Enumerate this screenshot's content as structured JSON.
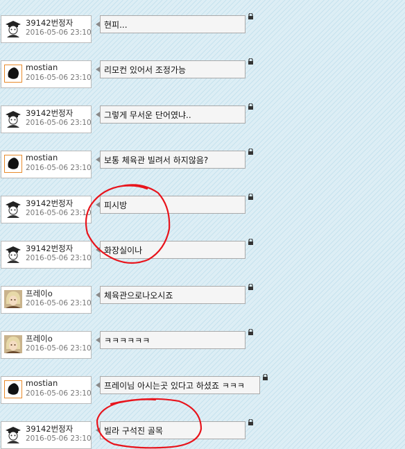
{
  "messages": [
    {
      "user": "39142번정자",
      "date": "2016-05-06 23:10",
      "text": "현피...",
      "avatar": "student-avatar-icon"
    },
    {
      "user": "mostian",
      "date": "2016-05-06 23:10",
      "text": "리모컨 있어서 조정가능",
      "avatar": "black-blob-avatar-icon"
    },
    {
      "user": "39142번정자",
      "date": "2016-05-06 23:10",
      "text": "그렇게 무서운 단어였냐..",
      "avatar": "student-avatar-icon"
    },
    {
      "user": "mostian",
      "date": "2016-05-06 23:10",
      "text": "보통 체육관 빌려서 하지않음?",
      "avatar": "black-blob-avatar-icon"
    },
    {
      "user": "39142번정자",
      "date": "2016-05-06 23:10",
      "text": "피시방",
      "avatar": "student-avatar-icon"
    },
    {
      "user": "39142번정자",
      "date": "2016-05-06 23:10",
      "text": "화장실이나",
      "avatar": "student-avatar-icon"
    },
    {
      "user": "프레이o",
      "date": "2016-05-06 23:10",
      "text": "체육관으로나오시죠",
      "avatar": "anime-character-avatar-icon"
    },
    {
      "user": "프레이o",
      "date": "2016-05-06 23:10",
      "text": "ㅋㅋㅋㅋㅋㅋ",
      "avatar": "anime-character-avatar-icon"
    },
    {
      "user": "mostian",
      "date": "2016-05-06 23:10",
      "text": "프레이님 아시는곳 있다고 하셨죠 ㅋㅋㅋ",
      "avatar": "black-blob-avatar-icon"
    },
    {
      "user": "39142번정자",
      "date": "2016-05-06 23:10",
      "text": "빌라 구석진 골목",
      "avatar": "student-avatar-icon"
    }
  ],
  "icons": {
    "lock": "lock-icon"
  },
  "colors": {
    "annotation": "#e8141c",
    "background": "#ddeef5"
  }
}
